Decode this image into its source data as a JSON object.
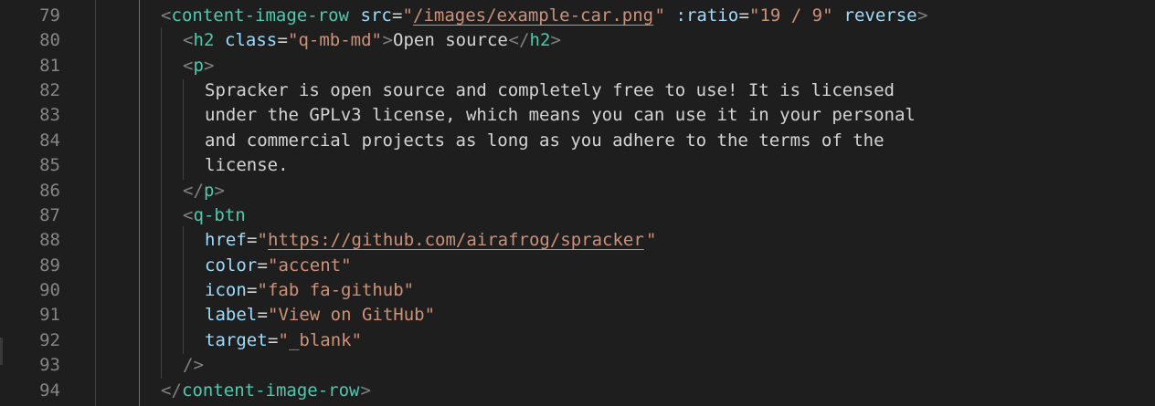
{
  "editor": {
    "lines": [
      {
        "number": "79",
        "tokens": [
          {
            "t": "punct",
            "v": "<"
          },
          {
            "t": "tag",
            "v": "content-image-row"
          },
          {
            "t": "text",
            "v": " "
          },
          {
            "t": "attr",
            "v": "src"
          },
          {
            "t": "text",
            "v": "="
          },
          {
            "t": "str",
            "v": "\""
          },
          {
            "t": "strlink",
            "v": "/images/example-car.png"
          },
          {
            "t": "str",
            "v": "\""
          },
          {
            "t": "text",
            "v": " "
          },
          {
            "t": "attr",
            "v": ":ratio"
          },
          {
            "t": "text",
            "v": "="
          },
          {
            "t": "str",
            "v": "\"19 / 9\""
          },
          {
            "t": "text",
            "v": " "
          },
          {
            "t": "attr",
            "v": "reverse"
          },
          {
            "t": "punct",
            "v": ">"
          }
        ]
      },
      {
        "number": "80",
        "tokens": [
          {
            "t": "punct",
            "v": "<"
          },
          {
            "t": "tag",
            "v": "h2"
          },
          {
            "t": "text",
            "v": " "
          },
          {
            "t": "attr",
            "v": "class"
          },
          {
            "t": "text",
            "v": "="
          },
          {
            "t": "str",
            "v": "\"q-mb-md\""
          },
          {
            "t": "punct",
            "v": ">"
          },
          {
            "t": "text",
            "v": "Open source"
          },
          {
            "t": "punct",
            "v": "</"
          },
          {
            "t": "tag",
            "v": "h2"
          },
          {
            "t": "punct",
            "v": ">"
          }
        ]
      },
      {
        "number": "81",
        "tokens": [
          {
            "t": "punct",
            "v": "<"
          },
          {
            "t": "tag",
            "v": "p"
          },
          {
            "t": "punct",
            "v": ">"
          }
        ]
      },
      {
        "number": "82",
        "tokens": [
          {
            "t": "text",
            "v": "Spracker is open source and completely free to use! It is licensed"
          }
        ]
      },
      {
        "number": "83",
        "tokens": [
          {
            "t": "text",
            "v": "under the GPLv3 license, which means you can use it in your personal"
          }
        ]
      },
      {
        "number": "84",
        "tokens": [
          {
            "t": "text",
            "v": "and commercial projects as long as you adhere to the terms of the"
          }
        ]
      },
      {
        "number": "85",
        "tokens": [
          {
            "t": "text",
            "v": "license."
          }
        ]
      },
      {
        "number": "86",
        "tokens": [
          {
            "t": "punct",
            "v": "</"
          },
          {
            "t": "tag",
            "v": "p"
          },
          {
            "t": "punct",
            "v": ">"
          }
        ]
      },
      {
        "number": "87",
        "tokens": [
          {
            "t": "punct",
            "v": "<"
          },
          {
            "t": "tag",
            "v": "q-btn"
          }
        ]
      },
      {
        "number": "88",
        "tokens": [
          {
            "t": "attr",
            "v": "href"
          },
          {
            "t": "text",
            "v": "="
          },
          {
            "t": "str",
            "v": "\""
          },
          {
            "t": "strlink",
            "v": "https://github.com/airafrog/spracker"
          },
          {
            "t": "str",
            "v": "\""
          }
        ]
      },
      {
        "number": "89",
        "tokens": [
          {
            "t": "attr",
            "v": "color"
          },
          {
            "t": "text",
            "v": "="
          },
          {
            "t": "str",
            "v": "\"accent\""
          }
        ]
      },
      {
        "number": "90",
        "tokens": [
          {
            "t": "attr",
            "v": "icon"
          },
          {
            "t": "text",
            "v": "="
          },
          {
            "t": "str",
            "v": "\"fab fa-github\""
          }
        ]
      },
      {
        "number": "91",
        "tokens": [
          {
            "t": "attr",
            "v": "label"
          },
          {
            "t": "text",
            "v": "="
          },
          {
            "t": "str",
            "v": "\"View on GitHub\""
          }
        ]
      },
      {
        "number": "92",
        "tokens": [
          {
            "t": "attr",
            "v": "target"
          },
          {
            "t": "text",
            "v": "="
          },
          {
            "t": "str",
            "v": "\"_blank\""
          }
        ]
      },
      {
        "number": "93",
        "tokens": [
          {
            "t": "punct",
            "v": "/>"
          }
        ]
      },
      {
        "number": "94",
        "tokens": [
          {
            "t": "punct",
            "v": "</"
          },
          {
            "t": "tag",
            "v": "content-image-row"
          },
          {
            "t": "punct",
            "v": ">"
          }
        ]
      }
    ]
  },
  "colors": {
    "background": "#1e1e1e",
    "line_number": "#858585",
    "tag": "#4ec9b0",
    "punctuation": "#808080",
    "attribute": "#9cdcfe",
    "string": "#ce9178",
    "text": "#d4d4d4"
  }
}
